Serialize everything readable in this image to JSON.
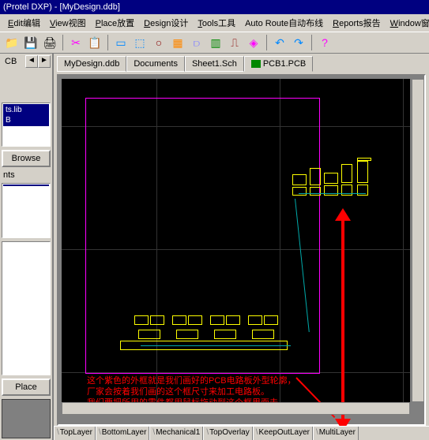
{
  "title": "(Protel DXP) - [MyDesign.ddb]",
  "menu": [
    {
      "label": "Edit编辑",
      "u": "E"
    },
    {
      "label": "View视图",
      "u": "V"
    },
    {
      "label": "Place放置",
      "u": "P"
    },
    {
      "label": "Design设计",
      "u": "D"
    },
    {
      "label": "Tools工具",
      "u": "T"
    },
    {
      "label": "Auto Route自动布线"
    },
    {
      "label": "Reports报告",
      "u": "R"
    },
    {
      "label": "Window窗"
    }
  ],
  "toolbar_icons": [
    "open",
    "save",
    "print",
    "sep",
    "cut",
    "sep",
    "scissors",
    "magnet",
    "sep",
    "rect",
    "rect2",
    "circle",
    "fill",
    "conn",
    "chip",
    "pin",
    "via",
    "sep",
    "undo",
    "redo",
    "sep",
    "help"
  ],
  "left": {
    "tab": "CB",
    "list1": [
      "ts.lib",
      "B"
    ],
    "browse": "Browse",
    "nts": "nts",
    "place": "Place"
  },
  "doc_tabs": [
    {
      "label": "MyDesign.ddb",
      "active": false
    },
    {
      "label": "Documents",
      "active": false
    },
    {
      "label": "Sheet1.Sch",
      "active": false
    },
    {
      "label": "PCB1.PCB",
      "active": true,
      "hasIcon": true
    }
  ],
  "annotation": [
    "这个紫色的外框就是我们画好的PCB电路板外型轮廓，",
    "厂家会按着我们画的这个框尺寸来加工电路板。",
    "我们要把所用的零件都用鼠标拖动到这个框里面去。"
  ],
  "layer_tabs": [
    "TopLayer",
    "BottomLayer",
    "Mechanical1",
    "TopOverlay",
    "KeepOutLayer",
    "MultiLayer"
  ]
}
